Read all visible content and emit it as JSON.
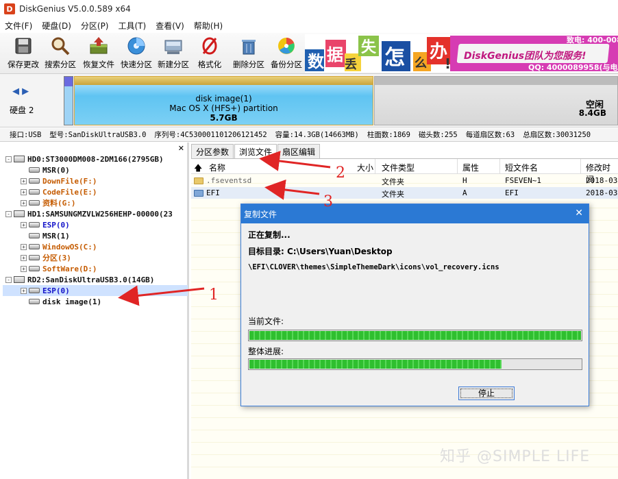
{
  "window": {
    "title": "DiskGenius V5.0.0.589 x64",
    "app_icon_letter": "D"
  },
  "menu": [
    "文件(F)",
    "硬盘(D)",
    "分区(P)",
    "工具(T)",
    "查看(V)",
    "帮助(H)"
  ],
  "toolbar": [
    {
      "label": "保存更改",
      "icon": "save-icon"
    },
    {
      "label": "搜索分区",
      "icon": "magnifier-icon"
    },
    {
      "label": "恢复文件",
      "icon": "recover-icon"
    },
    {
      "label": "快速分区",
      "icon": "quick-partition-icon"
    },
    {
      "label": "新建分区",
      "icon": "new-partition-icon"
    },
    {
      "label": "格式化",
      "icon": "format-icon"
    },
    {
      "label": "删除分区",
      "icon": "delete-icon"
    },
    {
      "label": "备份分区",
      "icon": "backup-icon"
    }
  ],
  "banner": {
    "chars": [
      "数",
      "据",
      "丢",
      "失",
      "怎",
      "么",
      "办",
      "!"
    ],
    "slogan": "DiskGenius团队为您服务!",
    "phone": "致电: 400-008",
    "qq": "QQ: 4000089958(与电"
  },
  "diskmap": {
    "disk_label": "硬盘 2",
    "partition": {
      "name": "disk image(1)",
      "fs": "Mac OS X (HFS+) partition",
      "size": "5.7GB"
    },
    "free": {
      "label": "空闲",
      "size": "8.4GB"
    }
  },
  "infoline": [
    "接口:USB",
    "型号:SanDiskUltraUSB3.0",
    "序列号:4C530001101206121452",
    "容量:14.3GB(14663MB)",
    "柱面数:1869",
    "磁头数:255",
    "每道扇区数:63",
    "总扇区数:30031250"
  ],
  "tree": [
    {
      "label": "HD0:ST3000DM008-2DM166(2795GB)",
      "level": 0,
      "type": "disk",
      "color": "#111111",
      "expander": "-"
    },
    {
      "label": "MSR(0)",
      "level": 1,
      "type": "vol",
      "color": "#111111",
      "expander": ""
    },
    {
      "label": "DownFile(F:)",
      "level": 1,
      "type": "vol",
      "color": "#c55b00",
      "expander": "+"
    },
    {
      "label": "CodeFile(E:)",
      "level": 1,
      "type": "vol",
      "color": "#c55b00",
      "expander": "+"
    },
    {
      "label": "资料(G:)",
      "level": 1,
      "type": "vol",
      "color": "#c55b00",
      "expander": "+"
    },
    {
      "label": "HD1:SAMSUNGMZVLW256HEHP-00000(23",
      "level": 0,
      "type": "disk",
      "color": "#111111",
      "expander": "-"
    },
    {
      "label": "ESP(0)",
      "level": 1,
      "type": "vol",
      "color": "#1313c9",
      "expander": "+"
    },
    {
      "label": "MSR(1)",
      "level": 1,
      "type": "vol",
      "color": "#111111",
      "expander": ""
    },
    {
      "label": "WindowOS(C:)",
      "level": 1,
      "type": "vol",
      "color": "#c55b00",
      "expander": "+"
    },
    {
      "label": "分区(3)",
      "level": 1,
      "type": "vol",
      "color": "#c55b00",
      "expander": "+"
    },
    {
      "label": "SoftWare(D:)",
      "level": 1,
      "type": "vol",
      "color": "#c55b00",
      "expander": "+"
    },
    {
      "label": "RD2:SanDiskUltraUSB3.0(14GB)",
      "level": 0,
      "type": "disk",
      "color": "#111111",
      "expander": "-"
    },
    {
      "label": "ESP(0)",
      "level": 1,
      "type": "vol",
      "color": "#1313c9",
      "expander": "+",
      "selected": true
    },
    {
      "label": "disk image(1)",
      "level": 1,
      "type": "vol",
      "color": "#111111",
      "expander": ""
    }
  ],
  "tabs": [
    {
      "label": "分区参数",
      "active": false
    },
    {
      "label": "浏览文件",
      "active": true
    },
    {
      "label": "扇区编辑",
      "active": false
    }
  ],
  "filelist": {
    "columns": [
      "名称",
      "大小",
      "文件类型",
      "属性",
      "短文件名",
      "修改时间"
    ],
    "rows": [
      {
        "name": ".fseventsd",
        "size": "",
        "type": "文件夹",
        "attr": "H",
        "short": "FSEVEN~1",
        "mtime": "2018-03-"
      },
      {
        "name": "EFI",
        "size": "",
        "type": "文件夹",
        "attr": "A",
        "short": "EFI",
        "mtime": "2018-03-",
        "selected": true
      }
    ]
  },
  "dialog": {
    "title": "复制文件",
    "status": "正在复制...",
    "target_label": "目标目录: C:\\Users\\Yuan\\Desktop",
    "current_path": "\\EFI\\CLOVER\\themes\\SimpleThemeDark\\icons\\vol_recovery.icns",
    "current_file_label": "当前文件:",
    "current_progress": 1.0,
    "overall_label": "整体进展:",
    "overall_progress": 0.76,
    "stop_label": "停止"
  },
  "annotations": [
    "1",
    "2",
    "3"
  ],
  "annotation_color": "#e02525",
  "watermark": "知乎 @SIMPLE LIFE"
}
